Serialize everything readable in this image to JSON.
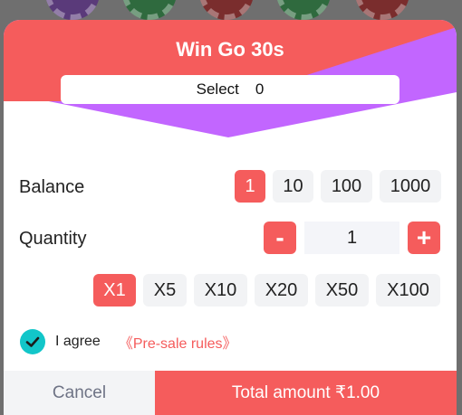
{
  "dialog": {
    "title": "Win Go 30s",
    "select_label": "Select",
    "select_value": "0",
    "header_colors": {
      "left": "#f55c5c",
      "right": "#c266ff"
    }
  },
  "balance": {
    "label": "Balance",
    "options": [
      "1",
      "10",
      "100",
      "1000"
    ],
    "selected": "1"
  },
  "quantity": {
    "label": "Quantity",
    "minus": "-",
    "plus": "+",
    "value": "1"
  },
  "multipliers": {
    "options": [
      "X1",
      "X5",
      "X10",
      "X20",
      "X50",
      "X100"
    ],
    "selected": "X1"
  },
  "agreement": {
    "checked": true,
    "text": "I agree",
    "rules_link": "《Pre-sale rules》"
  },
  "footer": {
    "cancel_label": "Cancel",
    "total_label": "Total amount ₹1.00"
  },
  "colors": {
    "accent": "#f55c5c",
    "check": "#12c6c9",
    "purple": "#c266ff"
  }
}
